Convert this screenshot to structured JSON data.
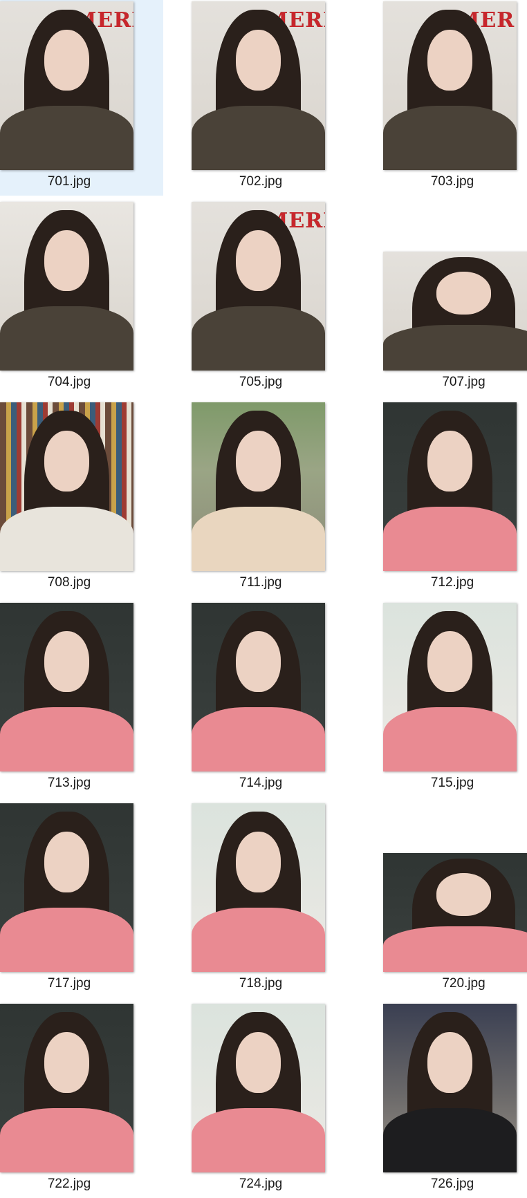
{
  "files": [
    {
      "name": "701.jpg",
      "selected": true,
      "scene": "wall",
      "top": "#4a4238",
      "banner": "MERR"
    },
    {
      "name": "702.jpg",
      "selected": false,
      "scene": "wall",
      "top": "#4a4238",
      "banner": "MERR"
    },
    {
      "name": "703.jpg",
      "selected": false,
      "scene": "wall",
      "top": "#4a4238",
      "banner": "MER"
    },
    {
      "name": "704.jpg",
      "selected": false,
      "scene": "room",
      "top": "#4a4238",
      "banner": ""
    },
    {
      "name": "705.jpg",
      "selected": false,
      "scene": "wall",
      "top": "#4a4238",
      "banner": "MERR"
    },
    {
      "name": "707.jpg",
      "selected": false,
      "scene": "wall",
      "top": "#4a4238",
      "banner": "",
      "landscape": true
    },
    {
      "name": "708.jpg",
      "selected": false,
      "scene": "collage",
      "top": "#e8e4dc",
      "banner": ""
    },
    {
      "name": "711.jpg",
      "selected": false,
      "scene": "garden",
      "top": "#e9d6bf",
      "banner": ""
    },
    {
      "name": "712.jpg",
      "selected": false,
      "scene": "dark",
      "top": "#e98a92",
      "banner": ""
    },
    {
      "name": "713.jpg",
      "selected": false,
      "scene": "dark",
      "top": "#e98a92",
      "banner": ""
    },
    {
      "name": "714.jpg",
      "selected": false,
      "scene": "dark",
      "top": "#e98a92",
      "banner": ""
    },
    {
      "name": "715.jpg",
      "selected": false,
      "scene": "light",
      "top": "#e98a92",
      "banner": ""
    },
    {
      "name": "717.jpg",
      "selected": false,
      "scene": "dark",
      "top": "#e98a92",
      "banner": ""
    },
    {
      "name": "718.jpg",
      "selected": false,
      "scene": "light",
      "top": "#e98a92",
      "banner": ""
    },
    {
      "name": "720.jpg",
      "selected": false,
      "scene": "dark",
      "top": "#e98a92",
      "banner": "",
      "landscape": true
    },
    {
      "name": "722.jpg",
      "selected": false,
      "scene": "dark",
      "top": "#e98a92",
      "banner": ""
    },
    {
      "name": "724.jpg",
      "selected": false,
      "scene": "light",
      "top": "#e98a92",
      "banner": ""
    },
    {
      "name": "726.jpg",
      "selected": false,
      "scene": "city",
      "top": "#1d1d1f",
      "banner": ""
    }
  ],
  "colors": {
    "selection": "#e5f1fb",
    "hair": "#2a201b",
    "skin": "#ecd2c3"
  }
}
